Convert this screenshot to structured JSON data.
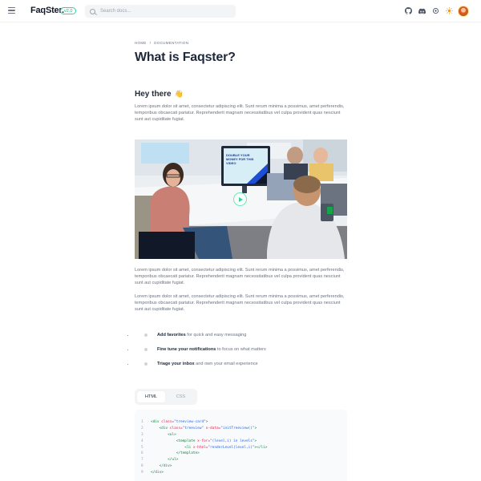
{
  "header": {
    "logo": "FaqSter.",
    "version": "v2.0",
    "search_placeholder": "Search docs...",
    "icons": [
      "github-icon",
      "discord-icon",
      "settings-icon",
      "sun-icon"
    ]
  },
  "breadcrumb": {
    "home": "HOME",
    "separator": "/",
    "current": "DOCUMENTATION"
  },
  "page_title": "What is Faqster?",
  "section": {
    "heading": "Hey there",
    "emoji": "👋"
  },
  "paragraphs": [
    "Lorem ipsum dolor sit amet, consectetur adipiscing elit. Sunt rerum minima a possimus, amet perferendis, temporibus obcaecati pariatur. Reprehenderit magnam necessitatibus vel culpa provident quas nesciunt sunt aut cupiditate fugiat.",
    "Lorem ipsum dolor sit amet, consectetur adipiscing elit. Sunt rerum minima a possimus, amet perferendis, temporibus obcaecati pariatur. Reprehenderit magnam necessitatibus vel culpa provident quas nesciunt sunt aut cupiditate fugiat.",
    "Lorem ipsum dolor sit amet, consectetur adipiscing elit. Sunt rerum minima a possimus, amet perferendis, temporibus obcaecati pariatur. Reprehenderit magnam necessitatibus vel culpa provident quas nesciunt sunt aut cupiditate fugiat."
  ],
  "video": {
    "monitor_text": "DOUBLE YOUR MONEY FOR THIS VIDEO"
  },
  "features": [
    {
      "bold": "Add favorites",
      "rest": " for quick and easy messaging"
    },
    {
      "bold": "Fine tune your notifications",
      "rest": " to focus on what matters"
    },
    {
      "bold": "Triage your inbox",
      "rest": " and own your email experience"
    }
  ],
  "tabs": [
    {
      "label": "HTML",
      "active": true
    },
    {
      "label": "CSS",
      "active": false
    }
  ],
  "code": {
    "line_numbers": [
      "1",
      "2",
      "3",
      "4",
      "5",
      "6",
      "7",
      "8",
      "9"
    ],
    "lines": [
      [
        "<div ",
        "class=",
        "\"treeview-card\"",
        ">"
      ],
      [
        "    <div ",
        "class=",
        "\"treeview\" ",
        "x-data=",
        "\"initTreeview()\"",
        ">"
      ],
      [
        "        <ul>",
        "",
        "",
        ""
      ],
      [
        "            <template ",
        "x-for=",
        "\"(level,i) in levels\"",
        ">"
      ],
      [
        "                <li ",
        "x-html=",
        "\"renderLevel(level,i)\"",
        "></li>"
      ],
      [
        "            </template>",
        "",
        "",
        ""
      ],
      [
        "        </ul>",
        "",
        "",
        ""
      ],
      [
        "    </div>",
        "",
        "",
        ""
      ],
      [
        "</div>",
        "",
        "",
        ""
      ]
    ]
  },
  "colors": {
    "accent_green": "#34d399",
    "title": "#1e293b",
    "body_text": "#6b7280",
    "code_tag": "#15803d",
    "code_attr": "#e11d48",
    "code_string": "#2563eb"
  }
}
